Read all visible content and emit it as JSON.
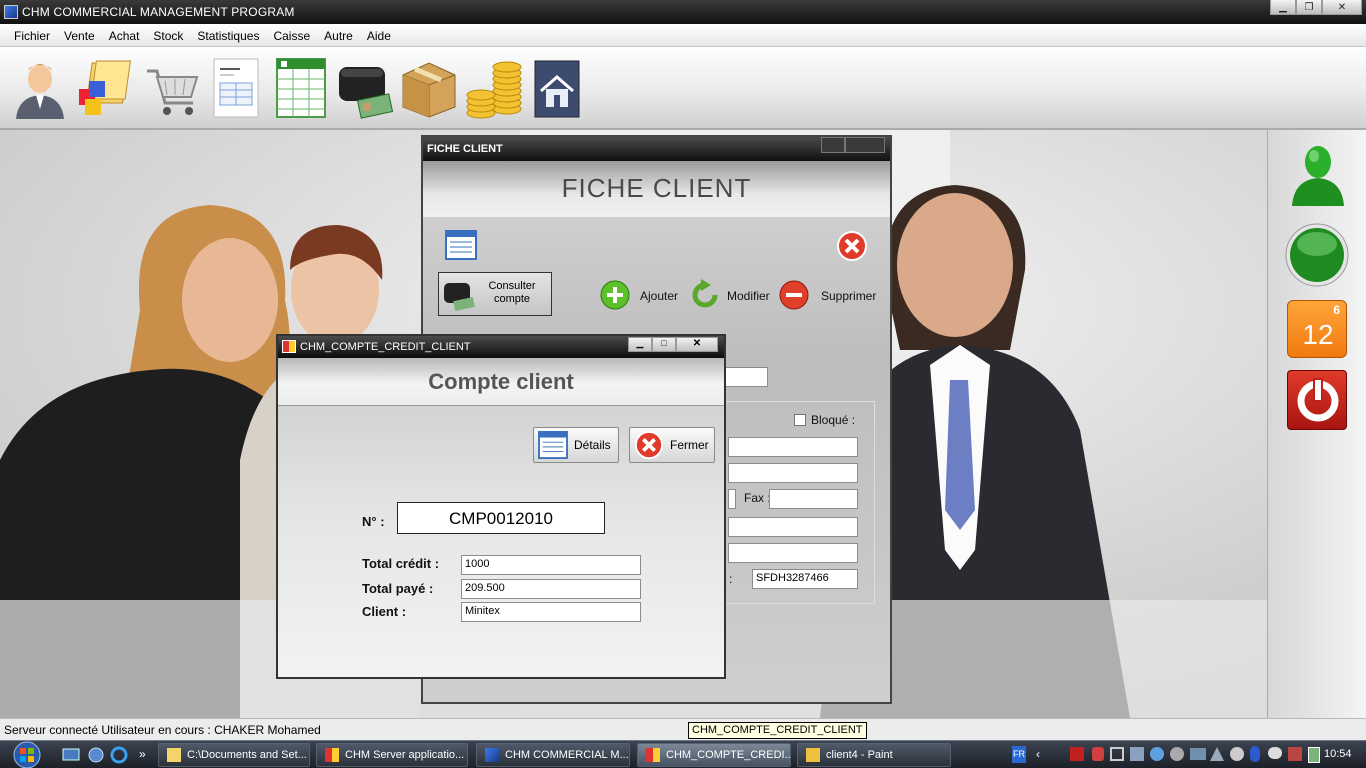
{
  "app": {
    "title": "CHM COMMERCIAL MANAGEMENT PROGRAM",
    "minimize": "▁",
    "maximize": "❐",
    "close": "✕"
  },
  "menu": [
    "Fichier",
    "Vente",
    "Achat",
    "Stock",
    "Statistiques",
    "Caisse",
    "Autre",
    "Aide"
  ],
  "toolbar_icons": [
    "user-icon",
    "boxes-icon",
    "cart-icon",
    "invoice-icon",
    "spreadsheet-icon",
    "wallet-icon",
    "package-icon",
    "coins-icon",
    "house-icon"
  ],
  "fiche": {
    "bar_title": "FICHE CLIENT",
    "header": "FICHE CLIENT",
    "consulter": "Consulter compte",
    "ajouter": "Ajouter",
    "modifier": "Modifier",
    "supprimer": "Supprimer",
    "bloque": "Bloqué :",
    "fax_label": "Fax :",
    "colon": ":",
    "code_value": "SFDH3287466"
  },
  "compte": {
    "bar_title": "CHM_COMPTE_CREDIT_CLIENT",
    "header": "Compte client",
    "details": "Détails",
    "fermer": "Fermer",
    "num_label": "N° :",
    "num_value": "CMP0012010",
    "credit_label": "Total crédit :",
    "credit_value": "1000",
    "paye_label": "Total payé :",
    "paye_value": "209.500",
    "client_label": "Client :",
    "client_value": "Minitex"
  },
  "right_panel": {
    "calendar_month": "6",
    "calendar_day": "12"
  },
  "status": {
    "text": "Serveur connecté   Utilisateur en cours : CHAKER Mohamed",
    "tooltip": "CHM_COMPTE_CREDIT_CLIENT"
  },
  "taskbar": {
    "tasks": [
      "C:\\Documents and Set...",
      "CHM Server applicatio...",
      "CHM COMMERCIAL M...",
      "CHM_COMPTE_CREDI...",
      "client4 - Paint"
    ],
    "lang": "FR",
    "clock": "10:54"
  },
  "colors": {
    "titlebar": "#111111",
    "accent_green": "#2e9e2e",
    "accent_red": "#c8201e",
    "accent_orange": "#f07a10"
  }
}
